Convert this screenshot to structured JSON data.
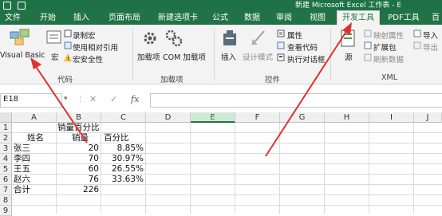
{
  "title_bar": {
    "title": "新建 Microsoft Excel 工作表 - E"
  },
  "tabs": [
    {
      "label": "文件"
    },
    {
      "label": "开始"
    },
    {
      "label": "插入"
    },
    {
      "label": "页面布局"
    },
    {
      "label": "新建选项卡"
    },
    {
      "label": "公式"
    },
    {
      "label": "数据"
    },
    {
      "label": "审阅"
    },
    {
      "label": "视图"
    },
    {
      "label": "开发工具",
      "active": true
    },
    {
      "label": "PDF工具"
    },
    {
      "label": "百"
    }
  ],
  "ribbon": {
    "code": {
      "visual_basic": "Visual Basic",
      "macros": "宏",
      "record_macro": "录制宏",
      "relative_ref": "使用相对引用",
      "macro_security": "宏安全性",
      "group": "代码"
    },
    "addins": {
      "addins": "加载项",
      "com": "COM 加载项",
      "group": "加载项"
    },
    "controls": {
      "insert": "插入",
      "design_mode": "设计模式",
      "properties": "属性",
      "view_code": "查看代码",
      "run_dialog": "执行对话框",
      "group": "控件"
    },
    "xml": {
      "source": "源",
      "map_props": "映射属性",
      "expansion_pack": "扩展包",
      "refresh_data": "刷新数据",
      "import": "导入",
      "export": "导出",
      "group": "XML"
    }
  },
  "formula_bar": {
    "name_box": "E18",
    "fx": "fx",
    "value": ""
  },
  "sheet": {
    "columns": [
      "A",
      "B",
      "C",
      "D",
      "E",
      "F",
      "G",
      "H",
      "I",
      "J"
    ],
    "selected_column": "E",
    "rows": [
      "1",
      "2",
      "3",
      "4",
      "5",
      "6",
      "7",
      "8",
      "9"
    ],
    "cells": {
      "B1": "销量百分比",
      "A2": "姓名",
      "B2": "销量",
      "C2": "百分比",
      "A3": "张三",
      "B3": "20",
      "C3": "8.85%",
      "A4": "李四",
      "B4": "70",
      "C4": "30.97%",
      "A5": "王五",
      "B5": "60",
      "C5": "26.55%",
      "A6": "赵六",
      "B6": "76",
      "C6": "33.63%",
      "A7": "合计",
      "B7": "226"
    }
  },
  "colors": {
    "excel_green": "#217346",
    "arrow_red": "#e0302f"
  }
}
